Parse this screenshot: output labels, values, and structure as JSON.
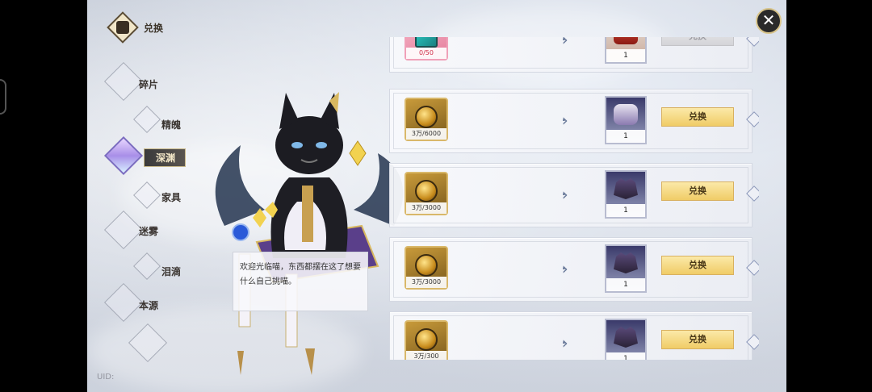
{
  "nav": {
    "title": "兑换",
    "items": [
      {
        "label": "碎片"
      },
      {
        "label": "精魄"
      },
      {
        "label": "深渊"
      },
      {
        "label": "家具"
      },
      {
        "label": "迷雾"
      },
      {
        "label": "泪滴"
      },
      {
        "label": "本源"
      }
    ],
    "active_index": 2
  },
  "npc": {
    "speech": "欢迎光临喵，东西都摆在这了想要什么自己挑喵。"
  },
  "uid_text": "UID:",
  "close_label": "✕",
  "exchange_rows": [
    {
      "cost": "0/50",
      "cost_icon": "crystal-shard-icon",
      "reward_count": "1",
      "reward_icon": "red-helmet-icon",
      "button": "兑换",
      "button_enabled": false
    },
    {
      "cost": "3万/6000",
      "cost_icon": "gold-crest-icon",
      "reward_count": "1",
      "reward_icon": "silver-armor-icon",
      "button": "兑换",
      "button_enabled": true
    },
    {
      "cost": "3万/3000",
      "cost_icon": "gold-crest-icon",
      "reward_count": "1",
      "reward_icon": "dark-armor-icon",
      "button": "兑换",
      "button_enabled": true
    },
    {
      "cost": "3万/3000",
      "cost_icon": "gold-crest-icon",
      "reward_count": "1",
      "reward_icon": "dark-armor-icon",
      "button": "兑换",
      "button_enabled": true
    },
    {
      "cost": "3万/300",
      "cost_icon": "gold-crest-icon",
      "reward_count": "1",
      "reward_icon": "dark-armor-icon",
      "button": "兑换",
      "button_enabled": true
    }
  ],
  "colors": {
    "button_active": "#f0cc66",
    "button_disabled": "#d4d4d8",
    "nav_active_bg": "#3a3a3a",
    "accent_gold": "#d8c48a"
  }
}
